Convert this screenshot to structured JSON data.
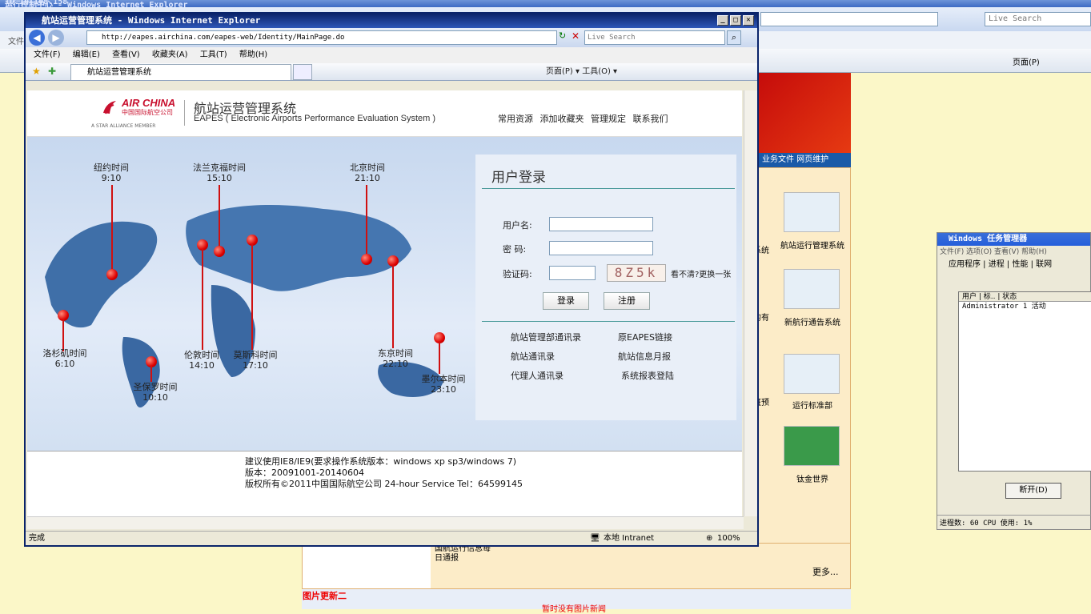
{
  "background_window": {
    "title": "运行控制中心 - Windows Internet Explorer",
    "ip": "10.10.108.158",
    "menu_file": "文件",
    "search_placeholder": "Live Search",
    "toolbar": "页面(P)",
    "tabs": "业务文件 网页维护",
    "thumbs": [
      {
        "label": "航站运行管理系统"
      },
      {
        "label": "新航行通告系统"
      },
      {
        "label": "运行标准部"
      },
      {
        "label": "钛金世界"
      }
    ],
    "left_labels": [
      "系统",
      "中心\n的有",
      "班预"
    ],
    "daily": "国航运行信息每\n日通报",
    "more": "更多...",
    "img_update": "图片更新二",
    "no_news": "暂时没有图片新闻"
  },
  "task_manager": {
    "title": "Windows 任务管理器",
    "menu": "文件(F) 选项(O) 查看(V) 帮助(H)",
    "tabs": "应用程序 | 进程 | 性能 | 联网",
    "columns": "用户          | 标.. | 状态",
    "row": "Administrator    1  活动",
    "button": "断开(D)",
    "status": "进程数: 60    CPU 使用: 1%"
  },
  "ie": {
    "title": "航站运营管理系统 - Windows Internet Explorer",
    "url": "http://eapes.airchina.com/eapes-web/Identity/MainPage.do",
    "search_placeholder": "Live Search",
    "menu": [
      "文件(F)",
      "编辑(E)",
      "查看(V)",
      "收藏夹(A)",
      "工具(T)",
      "帮助(H)"
    ],
    "tab_label": "航站运营管理系统",
    "tools": "页面(P) ▾  工具(O) ▾",
    "status_left": "完成",
    "status_zone": "本地 Intranet",
    "zoom": "100%"
  },
  "page": {
    "logo_en": "AIR CHINA",
    "logo_cn": "中国国际航空公司",
    "star_alliance": "A STAR ALLIANCE MEMBER",
    "system_cn": "航站运营管理系统",
    "system_en": "EAPES ( Electronic Airports Performance Evaluation System )",
    "top_links": [
      "常用资源",
      "添加收藏夹",
      "管理规定",
      "联系我们"
    ],
    "cities": [
      {
        "name": "纽约时间",
        "time": "9:10"
      },
      {
        "name": "法兰克福时间",
        "time": "15:10"
      },
      {
        "name": "北京时间",
        "time": "21:10"
      },
      {
        "name": "洛杉矶时间",
        "time": "6:10"
      },
      {
        "name": "伦敦时间",
        "time": "14:10"
      },
      {
        "name": "莫斯科时间",
        "time": "17:10"
      },
      {
        "name": "东京时间",
        "time": "22:10"
      },
      {
        "name": "圣保罗时间",
        "time": "10:10"
      },
      {
        "name": "墨尔本时间",
        "time": "23:10"
      }
    ],
    "login": {
      "title": "用户登录",
      "username_label": "用户名:",
      "password_label": "密  码:",
      "captcha_label": "验证码:",
      "captcha_text": "8Z5k",
      "refresh": "看不清?更换一张",
      "login_btn": "登录",
      "register_btn": "注册",
      "links": [
        "航站管理部通讯录",
        "原EAPES链接",
        "航站通讯录",
        "航站信息月报",
        "代理人通讯录",
        "系统报表登陆"
      ]
    },
    "footer": {
      "line1": "建议使用IE8/IE9(要求操作系统版本：windows xp sp3/windows 7)",
      "line2": "版本：20091001-20140604",
      "line3": "版权所有©2011中国国际航空公司 24-hour Service Tel：64599145"
    }
  }
}
